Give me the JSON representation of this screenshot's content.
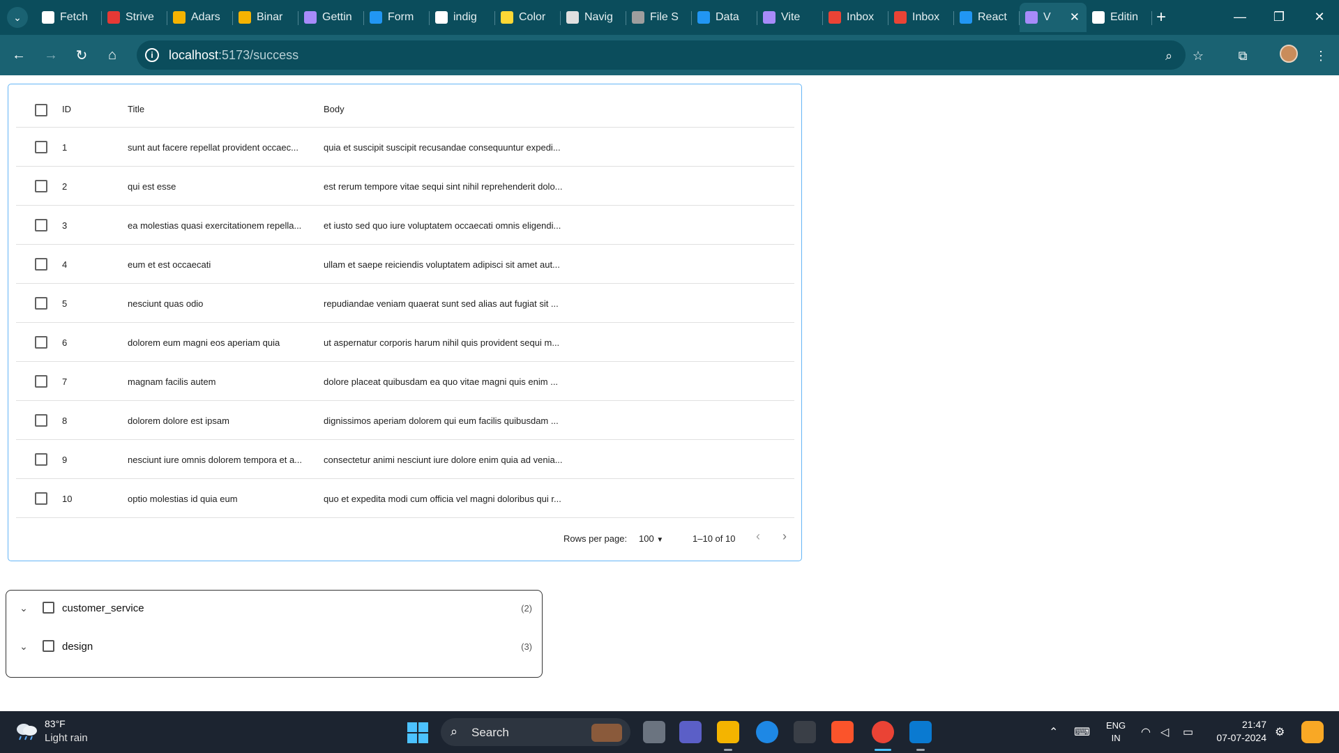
{
  "browser": {
    "tabs": [
      {
        "label": "Fetch",
        "color": "#ffffff"
      },
      {
        "label": "Strive",
        "color": "#e53935"
      },
      {
        "label": "Adars",
        "color": "#f5b301"
      },
      {
        "label": "Binar",
        "color": "#f5b301"
      },
      {
        "label": "Gettin",
        "color": "#a78bfa"
      },
      {
        "label": "Form",
        "color": "#2196f3"
      },
      {
        "label": "indig",
        "color": "#ffffff"
      },
      {
        "label": "Color",
        "color": "#fdd835"
      },
      {
        "label": "Navig",
        "color": "#e0e0e0"
      },
      {
        "label": "File S",
        "color": "#9e9e9e"
      },
      {
        "label": "Data",
        "color": "#2196f3"
      },
      {
        "label": "Vite",
        "color": "#a78bfa"
      },
      {
        "label": "Inbox",
        "color": "#ea4335"
      },
      {
        "label": "Inbox",
        "color": "#ea4335"
      },
      {
        "label": "React",
        "color": "#2196f3"
      },
      {
        "label": "V",
        "color": "#a78bfa"
      },
      {
        "label": "Editin",
        "color": "#ffffff"
      }
    ],
    "url_host": "localhost",
    "url_rest": ":5173/success"
  },
  "grid": {
    "headers": {
      "id": "ID",
      "title": "Title",
      "body": "Body"
    },
    "rows": [
      {
        "id": "1",
        "title": "sunt aut facere repellat provident occaec...",
        "body": "quia et suscipit suscipit recusandae consequuntur expedi..."
      },
      {
        "id": "2",
        "title": "qui est esse",
        "body": "est rerum tempore vitae sequi sint nihil reprehenderit dolo..."
      },
      {
        "id": "3",
        "title": "ea molestias quasi exercitationem repella...",
        "body": "et iusto sed quo iure voluptatem occaecati omnis eligendi..."
      },
      {
        "id": "4",
        "title": "eum et est occaecati",
        "body": "ullam et saepe reiciendis voluptatem adipisci sit amet aut..."
      },
      {
        "id": "5",
        "title": "nesciunt quas odio",
        "body": "repudiandae veniam quaerat sunt sed alias aut fugiat sit ..."
      },
      {
        "id": "6",
        "title": "dolorem eum magni eos aperiam quia",
        "body": "ut aspernatur corporis harum nihil quis provident sequi m..."
      },
      {
        "id": "7",
        "title": "magnam facilis autem",
        "body": "dolore placeat quibusdam ea quo vitae magni quis enim ..."
      },
      {
        "id": "8",
        "title": "dolorem dolore est ipsam",
        "body": "dignissimos aperiam dolorem qui eum facilis quibusdam ..."
      },
      {
        "id": "9",
        "title": "nesciunt iure omnis dolorem tempora et a...",
        "body": "consectetur animi nesciunt iure dolore enim quia ad venia..."
      },
      {
        "id": "10",
        "title": "optio molestias id quia eum",
        "body": "quo et expedita modi cum officia vel magni doloribus qui r..."
      }
    ],
    "footer": {
      "rows_per_page_label": "Rows per page:",
      "rows_per_page_value": "100",
      "range": "1–10 of 10"
    }
  },
  "tree": {
    "items": [
      {
        "label": "customer_service",
        "count": "(2)"
      },
      {
        "label": "design",
        "count": "(3)"
      }
    ]
  },
  "taskbar": {
    "weather_temp": "83°F",
    "weather_desc": "Light rain",
    "search_label": "Search",
    "lang_line1": "ENG",
    "lang_line2": "IN",
    "time": "21:47",
    "date": "07-07-2024"
  }
}
